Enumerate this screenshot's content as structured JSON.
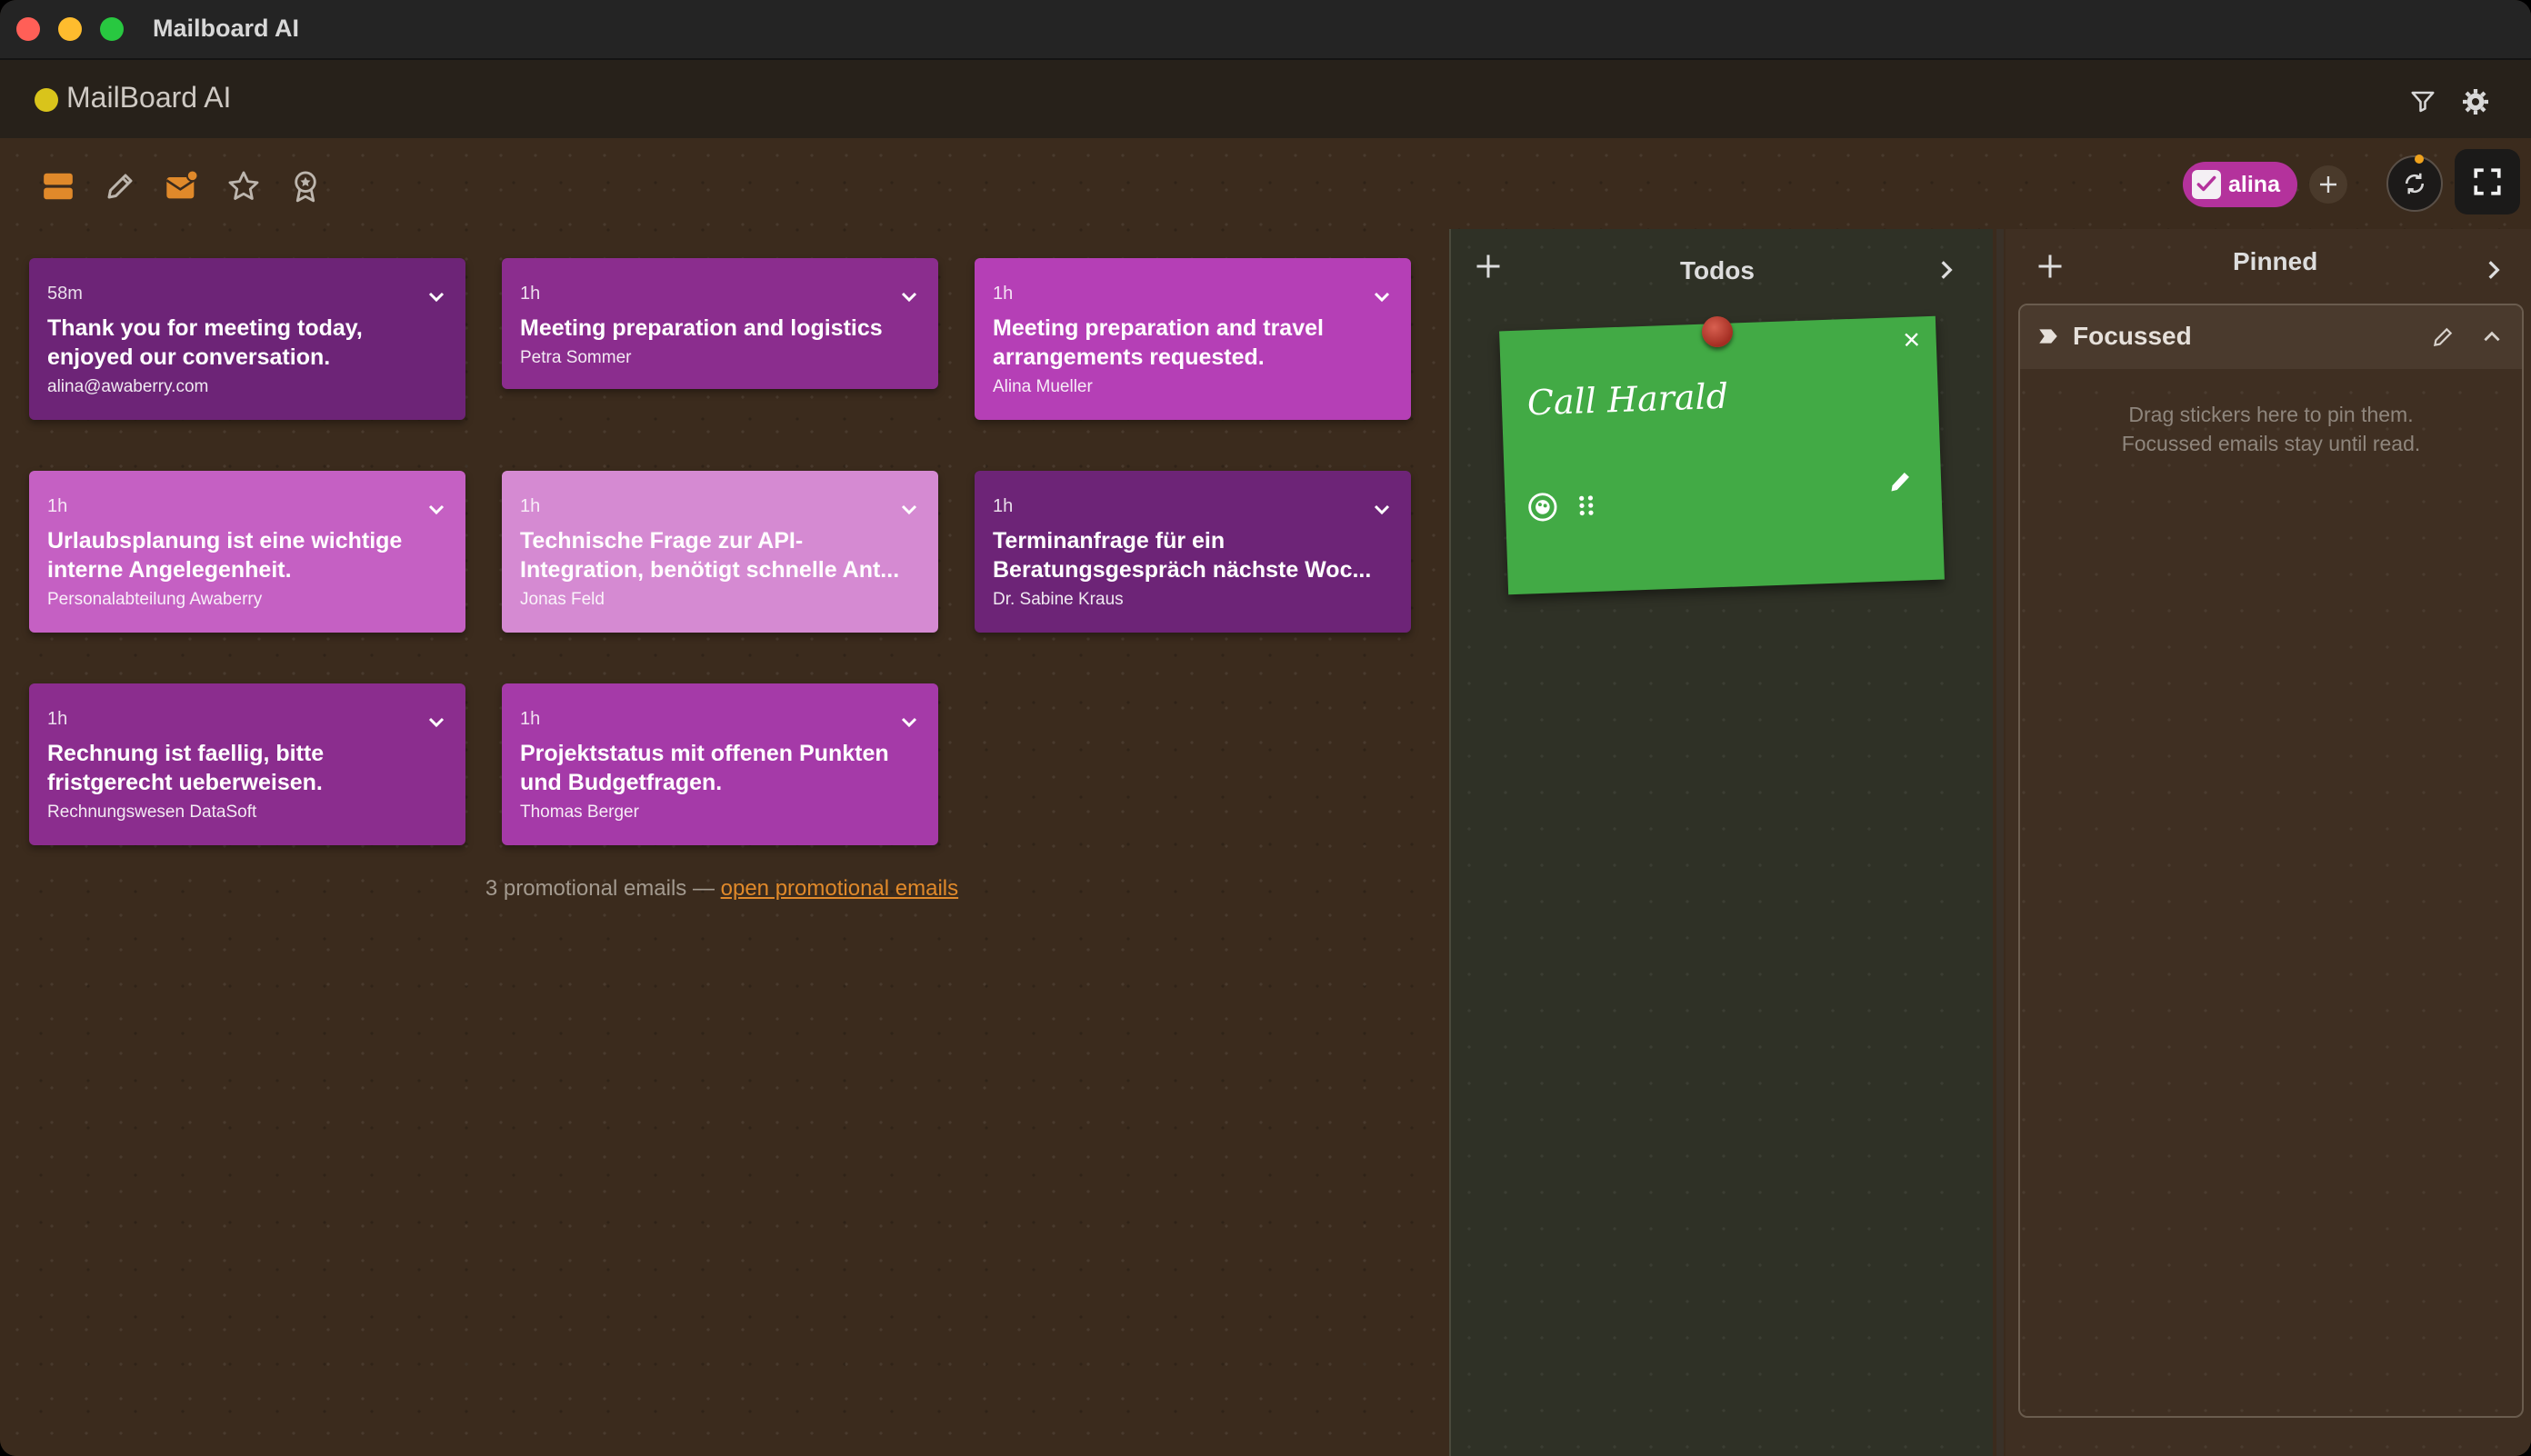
{
  "window": {
    "title": "Mailboard AI"
  },
  "header": {
    "brand": "MailBoard AI",
    "brand_dot_color": "#d9c41b",
    "icons": [
      "filter-icon",
      "settings-icon"
    ]
  },
  "toolbar": {
    "icons": [
      "stack-icon",
      "pencil-icon",
      "mail-badge-icon",
      "star-icon",
      "award-icon"
    ]
  },
  "account": {
    "name": "alina",
    "color": "#b4329c"
  },
  "emails": [
    {
      "time": "58m",
      "title": "Thank you for meeting today, enjoyed our conversation.",
      "sender": "alina@awaberry.com",
      "color": "#6d2477"
    },
    {
      "time": "1h",
      "title": "Meeting preparation and logistics",
      "sender": "Petra Sommer",
      "color": "#8b2d8e"
    },
    {
      "time": "1h",
      "title": "Meeting preparation and travel arrangements requested.",
      "sender": "Alina Mueller",
      "color": "#b53fb6"
    },
    {
      "time": "1h",
      "title": "Urlaubsplanung ist eine wichtige interne Angelegenheit.",
      "sender": "Personalabteilung Awaberry",
      "color": "#c560c3"
    },
    {
      "time": "1h",
      "title": "Technische Frage zur API-Integration, benötigt schnelle Ant...",
      "sender": "Jonas Feld",
      "color": "#d58ad2"
    },
    {
      "time": "1h",
      "title": "Terminanfrage für ein Beratungsgespräch nächste Woc...",
      "sender": "Dr. Sabine Kraus",
      "color": "#6d2477"
    },
    {
      "time": "1h",
      "title": "Rechnung ist faellig, bitte fristgerecht ueberweisen.",
      "sender": "Rechnungswesen DataSoft",
      "color": "#8b2d8e"
    },
    {
      "time": "1h",
      "title": "Projektstatus mit offenen Punkten und Budgetfragen.",
      "sender": "Thomas Berger",
      "color": "#a53aa8"
    }
  ],
  "promo": {
    "text": "3 promotional emails —",
    "link": "open promotional emails"
  },
  "todos": {
    "title": "Todos",
    "sticky_text": "Call Harald",
    "sticky_color": "#42aa45"
  },
  "pinned": {
    "title": "Pinned",
    "focus_title": "Focussed",
    "hint_line1": "Drag stickers here to pin them.",
    "hint_line2": "Focussed emails stay until read."
  }
}
